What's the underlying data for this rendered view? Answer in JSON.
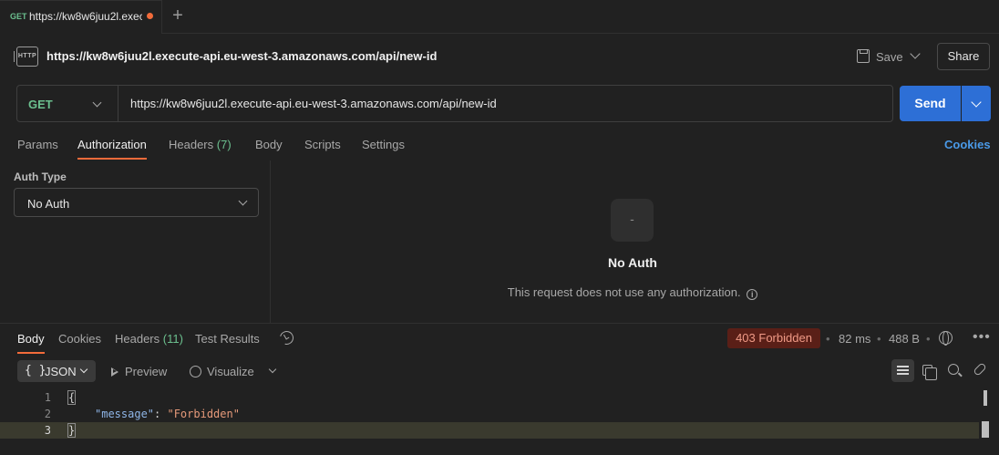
{
  "tab": {
    "method": "GET",
    "url": "https://kw8w6juu2l.execute-api.eu-west-3.amazonaws.com/api/new-id",
    "new_tab_symbol": "+"
  },
  "header": {
    "icon_label": "HTTP",
    "title": "https://kw8w6juu2l.execute-api.eu-west-3.amazonaws.com/api/new-id",
    "save_label": "Save",
    "share_label": "Share"
  },
  "request": {
    "method": "GET",
    "url": "https://kw8w6juu2l.execute-api.eu-west-3.amazonaws.com/api/new-id",
    "send_label": "Send",
    "method_color": "#6bbf8e",
    "send_color": "#2d6fd6"
  },
  "request_tabs": {
    "params": "Params",
    "authorization": "Authorization",
    "headers": "Headers",
    "headers_count": "(7)",
    "body": "Body",
    "scripts": "Scripts",
    "settings": "Settings",
    "cookies": "Cookies"
  },
  "auth": {
    "type_label": "Auth Type",
    "selected": "No Auth",
    "icon_glyph": "-",
    "empty_title": "No Auth",
    "empty_desc": "This request does not use any authorization.",
    "info_glyph": "i"
  },
  "response_tabs": {
    "body": "Body",
    "cookies": "Cookies",
    "headers": "Headers",
    "headers_count": "(11)",
    "test_results": "Test Results"
  },
  "response_meta": {
    "status": "403 Forbidden",
    "time": "82 ms",
    "size": "488 B",
    "status_bg": "#5a1f17",
    "status_fg": "#f09a86"
  },
  "response_toolbar": {
    "format_braces": "{ }",
    "format": "JSON",
    "preview": "Preview",
    "visualize": "Visualize"
  },
  "editor": {
    "lines": [
      {
        "num": "1",
        "open": "{"
      },
      {
        "num": "2",
        "key": "\"message\"",
        "sep": ": ",
        "value": "\"Forbidden\""
      },
      {
        "num": "3",
        "close": "}"
      }
    ]
  }
}
